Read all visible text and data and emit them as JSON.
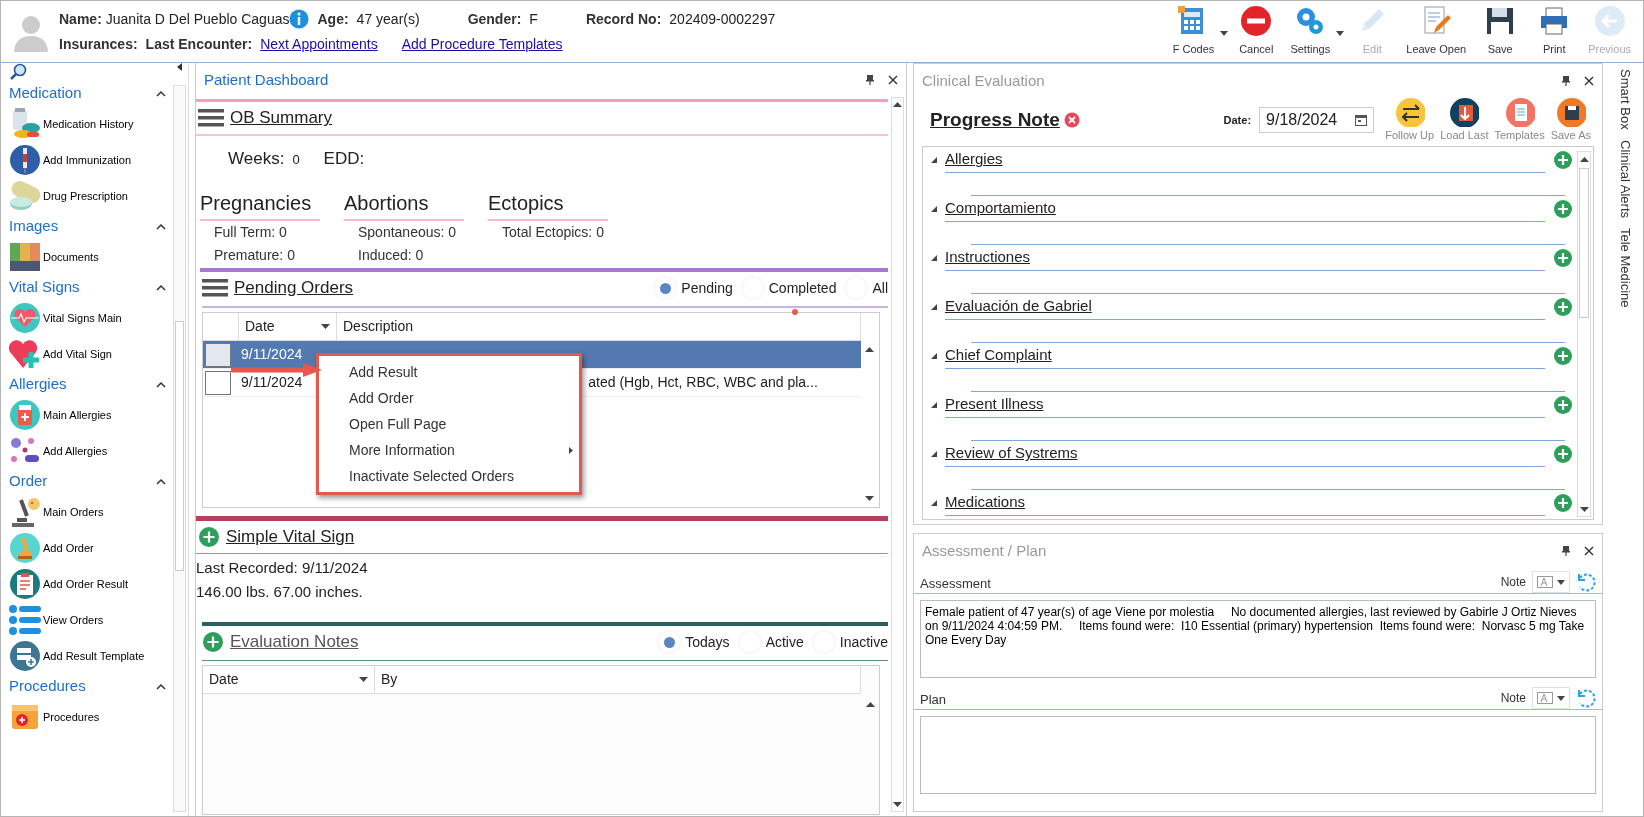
{
  "patient": {
    "name_label": "Name:",
    "name": "Juanita D Del Pueblo Caguas",
    "age_label": "Age:",
    "age": "47 year(s)",
    "gender_label": "Gender:",
    "gender": "F",
    "record_label": "Record No:",
    "record": "202409-0002297",
    "insurances_label": "Insurances:",
    "last_encounter_label": "Last Encounter:",
    "links": [
      "Next Appointments",
      "Add Procedure Templates"
    ]
  },
  "toolbar": [
    {
      "label": "F Codes",
      "dropdown": true,
      "disabled": false
    },
    {
      "label": "Cancel",
      "dropdown": false,
      "disabled": false
    },
    {
      "label": "Settings",
      "dropdown": true,
      "disabled": false
    },
    {
      "label": "Edit",
      "dropdown": false,
      "disabled": true
    },
    {
      "label": "Leave Open",
      "dropdown": false,
      "disabled": false
    },
    {
      "label": "Save",
      "dropdown": false,
      "disabled": false
    },
    {
      "label": "Print",
      "dropdown": false,
      "disabled": false
    },
    {
      "label": "Previous",
      "dropdown": false,
      "disabled": true
    }
  ],
  "sidebar": {
    "groups": [
      {
        "title": "Medication",
        "expanded": true,
        "items": [
          "Medication History",
          "Add Immunization",
          "Drug Prescription"
        ]
      },
      {
        "title": "Images",
        "expanded": true,
        "items": [
          "Documents"
        ]
      },
      {
        "title": "Vital Signs",
        "expanded": true,
        "items": [
          "Vital Signs Main",
          "Add Vital Sign"
        ]
      },
      {
        "title": "Allergies",
        "expanded": true,
        "items": [
          "Main Allergies",
          "Add Allergies"
        ]
      },
      {
        "title": "Order",
        "expanded": true,
        "items": [
          "Main Orders",
          "Add Order",
          "Add Order Result",
          "View Orders",
          "Add Result Template"
        ]
      },
      {
        "title": "Procedures",
        "expanded": true,
        "items": [
          "Procedures"
        ]
      }
    ]
  },
  "dashboard": {
    "title": "Patient Dashboard",
    "ob_summary": {
      "title": "OB Summary",
      "weeks_label": "Weeks:",
      "weeks": "0",
      "edd_label": "EDD:",
      "groups": [
        {
          "title": "Pregnancies",
          "rows": [
            {
              "label": "Full Term:",
              "value": "0"
            },
            {
              "label": "Premature:",
              "value": "0"
            }
          ]
        },
        {
          "title": "Abortions",
          "rows": [
            {
              "label": "Spontaneous:",
              "value": "0"
            },
            {
              "label": "Induced:",
              "value": "0"
            }
          ]
        },
        {
          "title": "Ectopics",
          "rows": [
            {
              "label": "Total Ectopics:",
              "value": "0"
            }
          ]
        }
      ]
    },
    "pending_orders": {
      "title": "Pending Orders",
      "filters": [
        {
          "label": "Pending",
          "selected": true
        },
        {
          "label": "Completed",
          "selected": false
        },
        {
          "label": "All",
          "selected": false
        }
      ],
      "columns": [
        "Date",
        "Description"
      ],
      "rows": [
        {
          "date": "9/11/2024",
          "selected": true,
          "checked": false
        },
        {
          "date": "9/11/2024",
          "description": "ated (Hgb, Hct, RBC, WBC and pla...",
          "selected": false,
          "checked": false
        }
      ]
    },
    "context_menu": [
      {
        "label": "Add Result",
        "submenu": false
      },
      {
        "label": "Add Order",
        "submenu": false
      },
      {
        "label": "Open Full Page",
        "submenu": false
      },
      {
        "label": "More Information",
        "submenu": true
      },
      {
        "label": "Inactivate Selected Orders",
        "submenu": false
      }
    ],
    "vital_sign": {
      "title": "Simple Vital Sign",
      "lines": [
        "Last Recorded: 9/11/2024",
        "146.00 lbs. 67.00 inches."
      ]
    },
    "evaluation_notes": {
      "title": "Evaluation Notes",
      "filters": [
        {
          "label": "Todays",
          "selected": true
        },
        {
          "label": "Active",
          "selected": false
        },
        {
          "label": "Inactive",
          "selected": false
        }
      ],
      "columns": [
        "Date",
        "By"
      ]
    }
  },
  "clinical": {
    "title": "Clinical Evaluation",
    "note_title": "Progress Note",
    "date_label": "Date:",
    "date": "9/18/2024",
    "actions": [
      "Follow Up",
      "Load Last",
      "Templates",
      "Save As"
    ],
    "sections": [
      {
        "title": "Allergies",
        "expanded": true
      },
      {
        "title": "Comportamiento",
        "expanded": true
      },
      {
        "title": "Instructiones",
        "expanded": true
      },
      {
        "title": "Evaluación de Gabriel",
        "expanded": true
      },
      {
        "title": "Chief Complaint",
        "expanded": true
      },
      {
        "title": "Present Illness",
        "expanded": true
      },
      {
        "title": "Review of Systrems",
        "expanded": true
      },
      {
        "title": "Medications",
        "expanded": true
      }
    ]
  },
  "assessment_plan": {
    "title": "Assessment / Plan",
    "fields": [
      {
        "label": "Assessment",
        "note_label": "Note",
        "value": "Female patient of 47 year(s) of age Viene por molestia     No documented allergies, last reviewed by Gabirle J Ortiz Nieves on 9/11/2024 4:04:59 PM.     Items found were:  I10 Essential (primary) hypertension  Items found were:  Norvasc 5 mg Take One Every Day"
      },
      {
        "label": "Plan",
        "note_label": "Note"
      }
    ]
  },
  "side_tabs": [
    "Smart Box",
    "Clinical Alerts",
    "Tele Medicine"
  ]
}
